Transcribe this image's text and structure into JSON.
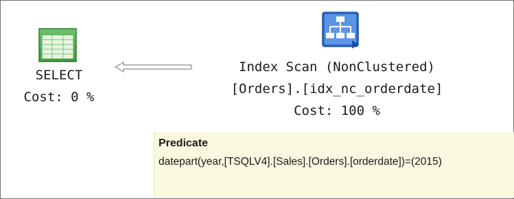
{
  "select_node": {
    "label": "SELECT",
    "cost": "Cost: 0 %",
    "icon": "select-table-icon"
  },
  "scan_node": {
    "title": "Index Scan (NonClustered)",
    "object": "[Orders].[idx_nc_orderdate]",
    "cost": "Cost: 100 %",
    "icon": "index-scan-icon"
  },
  "tooltip": {
    "heading": "Predicate",
    "text": "datepart(year,[TSQLV4].[Sales].[Orders].[orderdate])=(2015)"
  },
  "colors": {
    "select_icon_green": "#49a349",
    "scan_icon_blue": "#2e6cc7",
    "tooltip_bg": "#fbf8e0"
  }
}
